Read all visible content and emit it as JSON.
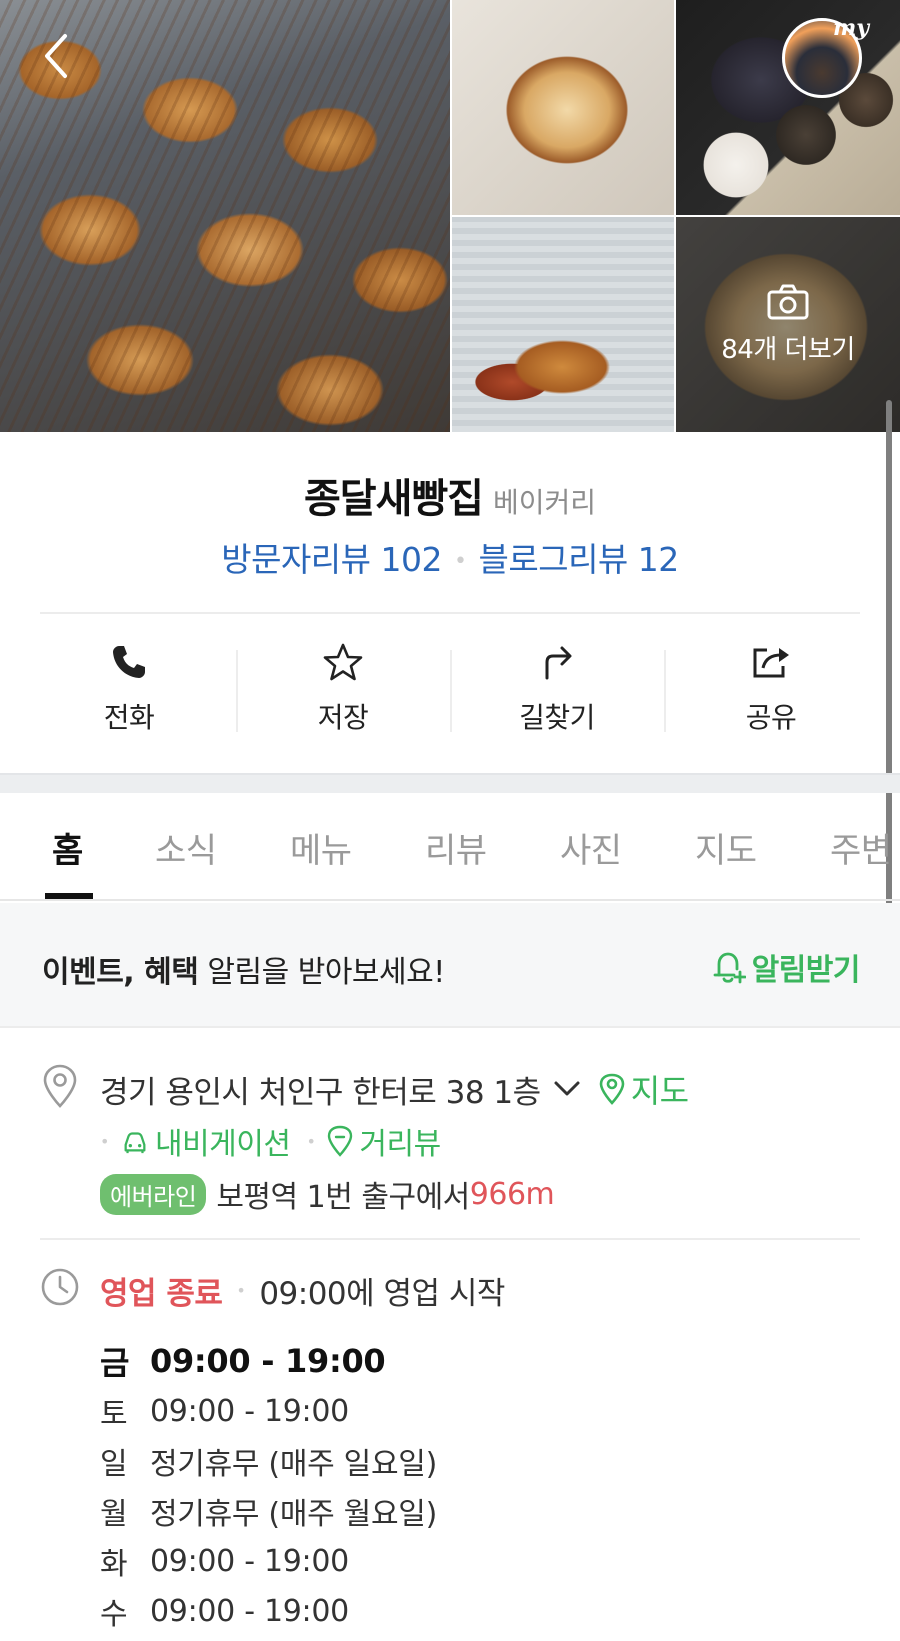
{
  "header": {
    "my_label": "my",
    "photo_more_label": "84개 더보기"
  },
  "place": {
    "name": "종달새빵집",
    "category": "베이커리",
    "visitor_review": "방문자리뷰 102",
    "blog_review": "블로그리뷰 12"
  },
  "actions": [
    {
      "label": "전화",
      "icon": "phone-icon"
    },
    {
      "label": "저장",
      "icon": "star-icon"
    },
    {
      "label": "길찾기",
      "icon": "directions-icon"
    },
    {
      "label": "공유",
      "icon": "share-icon"
    }
  ],
  "tabs": [
    {
      "label": "홈",
      "active": true
    },
    {
      "label": "소식"
    },
    {
      "label": "메뉴"
    },
    {
      "label": "리뷰"
    },
    {
      "label": "사진"
    },
    {
      "label": "지도"
    },
    {
      "label": "주변"
    }
  ],
  "notice": {
    "bold_text": "이벤트, 혜택",
    "text": " 알림을 받아보세요!",
    "button": "알림받기"
  },
  "address": {
    "text": "경기 용인시 처인구 한터로 38 1층",
    "map_link": "지도",
    "navigation_link": "내비게이션",
    "streetview_link": "거리뷰",
    "subway_line": "에버라인",
    "subway_text": "보평역 1번 출구에서 ",
    "distance": "966m"
  },
  "hours": {
    "status": "영업 종료",
    "next": "09:00에 영업 시작",
    "rows": [
      {
        "day": "금",
        "time": "09:00 - 19:00",
        "today": true
      },
      {
        "day": "토",
        "time": "09:00 - 19:00"
      },
      {
        "day": "일",
        "time": "정기휴무 (매주 일요일)"
      },
      {
        "day": "월",
        "time": "정기휴무 (매주 월요일)"
      },
      {
        "day": "화",
        "time": "09:00 - 19:00"
      },
      {
        "day": "수",
        "time": "09:00 - 19:00"
      }
    ]
  },
  "colors": {
    "accent_green": "#3ab55d",
    "link_blue": "#2a66b8",
    "closed_red": "#e0555a"
  }
}
